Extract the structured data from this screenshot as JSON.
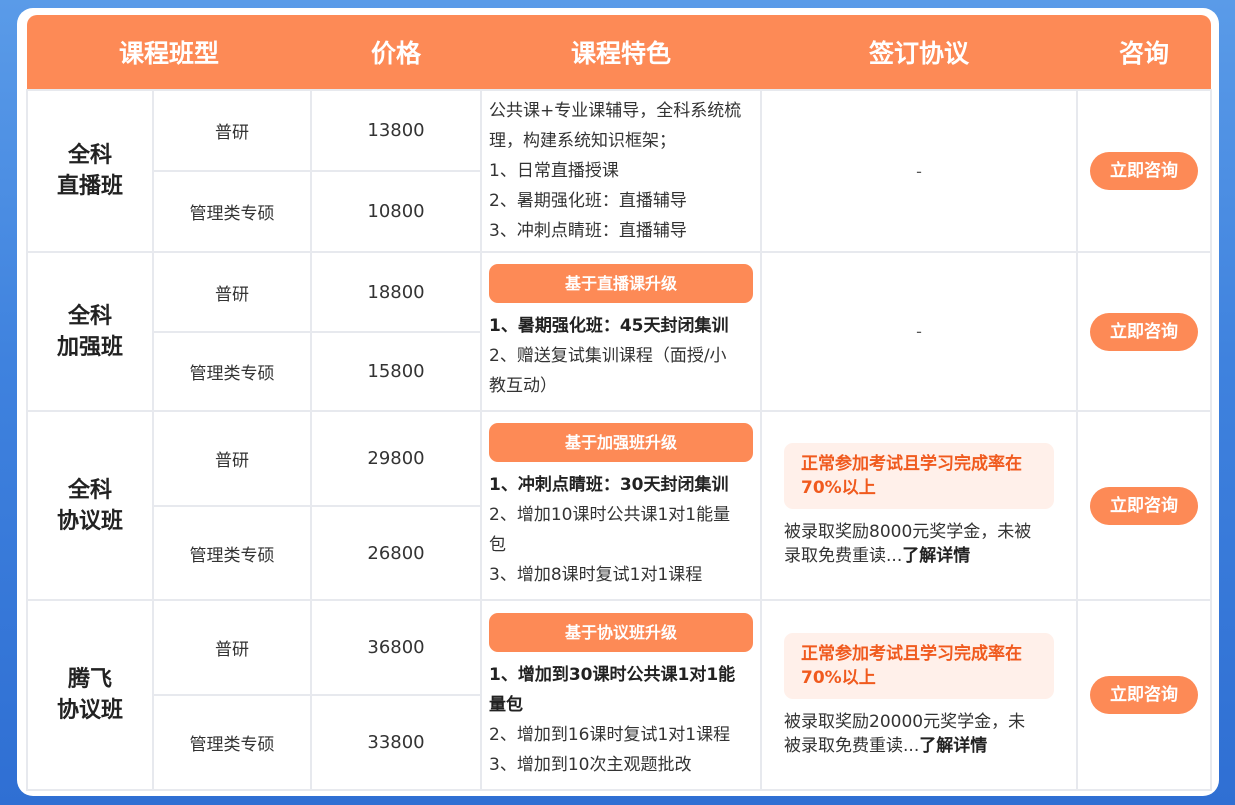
{
  "headers": {
    "type": "课程班型",
    "price": "价格",
    "features": "课程特色",
    "agreement": "签订协议",
    "consult": "咨询"
  },
  "rows": [
    {
      "name_line1": "全科",
      "name_line2": "直播班",
      "sub1": "普研",
      "price1": "13800",
      "sub2": "管理类专硕",
      "price2": "10800",
      "features": [
        "公共课+专业课辅导，全科系统梳",
        "理，构建系统知识框架；",
        "1、日常直播授课",
        "2、暑期强化班：直播辅导",
        "3、冲刺点睛班：直播辅导"
      ],
      "agreement": "-",
      "consult": "立即咨询"
    },
    {
      "name_line1": "全科",
      "name_line2": "加强班",
      "sub1": "普研",
      "price1": "18800",
      "sub2": "管理类专硕",
      "price2": "15800",
      "upgrade": "基于直播课升级",
      "feature_bold": "1、暑期强化班：45天封闭集训",
      "features": [
        "2、赠送复试集训课程（面授/小",
        "教互动）"
      ],
      "agreement": "-",
      "consult": "立即咨询"
    },
    {
      "name_line1": "全科",
      "name_line2": "协议班",
      "sub1": "普研",
      "price1": "29800",
      "sub2": "管理类专硕",
      "price2": "26800",
      "upgrade": "基于加强班升级",
      "feature_bold": "1、冲刺点睛班：30天封闭集训",
      "features": [
        "2、增加10课时公共课1对1能量",
        "包",
        "3、增加8课时复试1对1课程"
      ],
      "cond_line1": "正常参加考试且学习完成率在",
      "cond_line2": "70%以上",
      "note_line1": "被录取奖励8000元奖学金，未被",
      "note_line2_prefix": "录取免费重读...",
      "note_link": "了解详情",
      "consult": "立即咨询"
    },
    {
      "name_line1": "腾飞",
      "name_line2": "协议班",
      "sub1": "普研",
      "price1": "36800",
      "sub2": "管理类专硕",
      "price2": "33800",
      "upgrade": "基于协议班升级",
      "feature_bold1": "1、增加到30课时公共课1对1能",
      "feature_bold2": "量包",
      "features": [
        "2、增加到16课时复试1对1课程",
        "3、增加到10次主观题批改"
      ],
      "cond_line1": "正常参加考试且学习完成率在",
      "cond_line2": "70%以上",
      "note_line1": "被录取奖励20000元奖学金，未",
      "note_line2_prefix": "被录取免费重读...",
      "note_link": "了解详情",
      "consult": "立即咨询"
    }
  ]
}
